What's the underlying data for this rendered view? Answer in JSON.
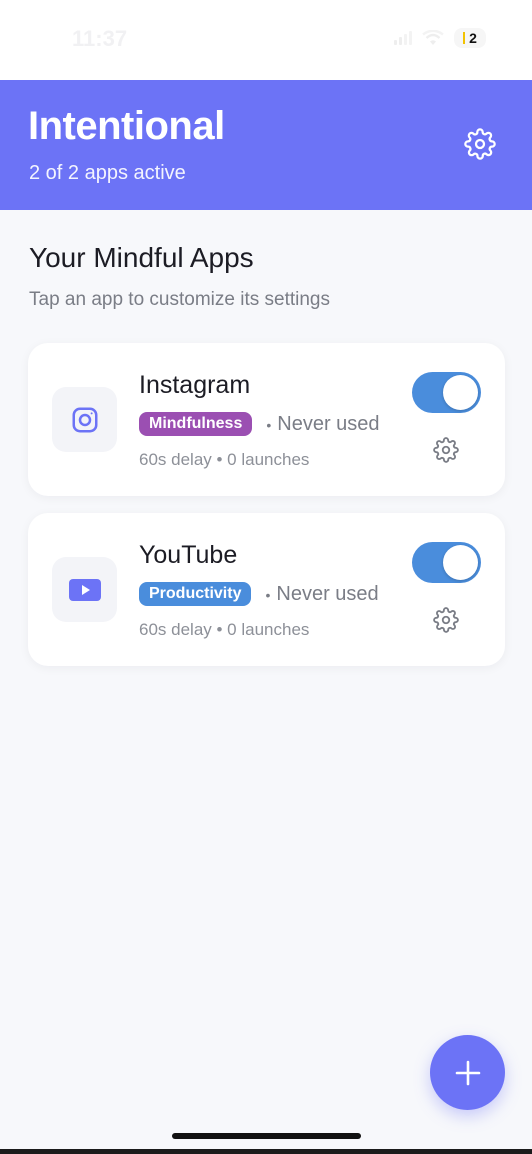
{
  "status_bar": {
    "time": "11:37",
    "battery": "2"
  },
  "header": {
    "title": "Intentional",
    "subtitle": "2 of 2 apps active",
    "settings_icon": "gear-icon"
  },
  "section": {
    "title": "Your Mindful Apps",
    "subtitle": "Tap an app to customize its settings"
  },
  "apps": [
    {
      "name": "Instagram",
      "icon": "instagram-icon",
      "category": "Mindfulness",
      "category_color": "#9b4fb2",
      "usage": "Never used",
      "stats": "60s delay • 0 launches",
      "enabled": true
    },
    {
      "name": "YouTube",
      "icon": "youtube-icon",
      "category": "Productivity",
      "category_color": "#4a8ddc",
      "usage": "Never used",
      "stats": "60s delay • 0 launches",
      "enabled": true
    }
  ],
  "fab": {
    "icon": "plus-icon"
  },
  "colors": {
    "accent": "#6c73f6",
    "toggle_on": "#4a8ddc",
    "background": "#f7f8fb"
  }
}
